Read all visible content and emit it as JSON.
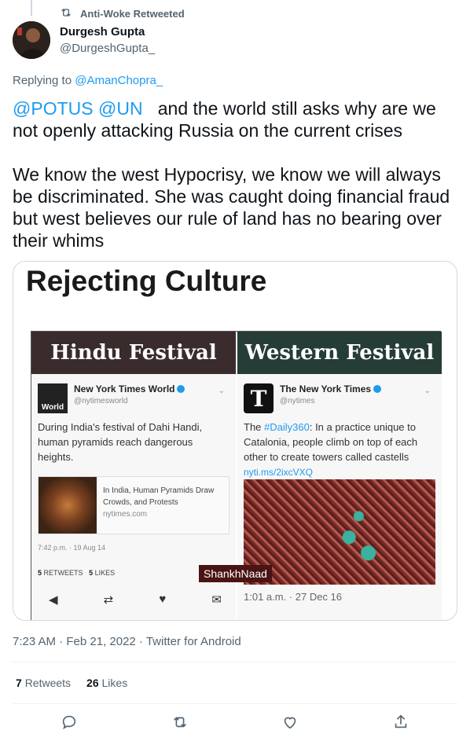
{
  "retweet": {
    "label": "Anti-Woke Retweeted"
  },
  "author": {
    "name": "Durgesh Gupta",
    "handle": "@DurgeshGupta_"
  },
  "reply": {
    "prefix": "Replying to ",
    "to": "@AmanChopra_"
  },
  "tweet": {
    "mention1": "@POTUS",
    "mention2": "@UN",
    "line1_rest": "and the world still asks why are we not openly attacking Russia on the current crises",
    "para2": "We know the west Hypocrisy, we know we will always be discriminated. She was caught doing financial fraud but west believes our rule of land has no bearing over their whims"
  },
  "media": {
    "title": "Rejecting Culture",
    "left": {
      "header": "Hindu Festival",
      "logo_text": "World",
      "account": "New York Times World",
      "handle": "@nytimesworld",
      "text": "During India's festival of Dahi Handi, human pyramids reach dangerous heights.",
      "link_title": "In India, Human Pyramids Draw Crowds, and Protests",
      "link_source": "nytimes.com",
      "time": "7:42 p.m. · 19 Aug 14",
      "retweets_count": "5",
      "retweets_label": "RETWEETS",
      "likes_count": "5",
      "likes_label": "LIKES"
    },
    "right": {
      "header": "Western Festival",
      "logo_text": "T",
      "account": "The New York Times",
      "handle": "@nytimes",
      "text_prefix": "The ",
      "hashtag": "#Daily360",
      "text_rest": ": In a practice unique to Catalonia, people climb on top of each other to create towers called castells",
      "link": "nyti.ms/2ixcVXQ",
      "time": "1:01 a.m. · 27 Dec 16"
    },
    "watermark": "ShankhNaad"
  },
  "meta": {
    "timestamp": "7:23 AM · Feb 21, 2022 · Twitter for Android",
    "retweets": "7",
    "retweets_label": "Retweets",
    "likes": "26",
    "likes_label": "Likes"
  },
  "colors": {
    "accent": "#1d9bf0",
    "muted": "#536471",
    "text": "#0f1419"
  },
  "icons": [
    "retweet-icon",
    "reply-icon",
    "like-icon",
    "share-icon"
  ]
}
